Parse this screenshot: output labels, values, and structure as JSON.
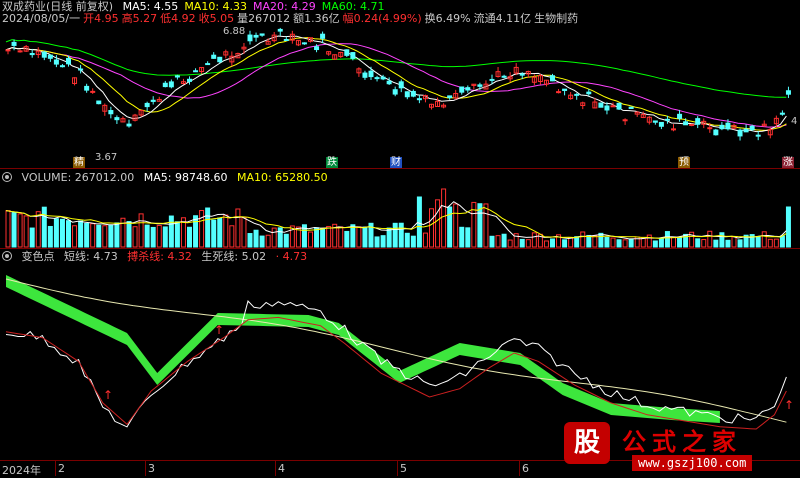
{
  "price_panel": {
    "title": "双成药业(日线 前复权)",
    "ma_items": [
      {
        "label": "MA5: 4.55",
        "color": "#ffffff"
      },
      {
        "label": "MA10: 4.33",
        "color": "#ffff00"
      },
      {
        "label": "MA20: 4.29",
        "color": "#ff44ff"
      },
      {
        "label": "MA60: 4.71",
        "color": "#00ff00"
      }
    ],
    "info_line": [
      {
        "label": "2024/08/05/一",
        "color": "#c8c8c8"
      },
      {
        "label": "开4.95",
        "color": "#ff3030"
      },
      {
        "label": "高5.27",
        "color": "#ff3030"
      },
      {
        "label": "低4.92",
        "color": "#ff3030"
      },
      {
        "label": "收5.05",
        "color": "#ff3030"
      },
      {
        "label": "量267012",
        "color": "#c8c8c8"
      },
      {
        "label": "额1.36亿",
        "color": "#c8c8c8"
      },
      {
        "label": "幅0.24(4.99%)",
        "color": "#ff3030"
      },
      {
        "label": "换6.49%",
        "color": "#c8c8c8"
      },
      {
        "label": "流通4.11亿",
        "color": "#c8c8c8"
      },
      {
        "label": "生物制药",
        "color": "#c8c8c8"
      }
    ],
    "high_label": "6.88",
    "low_label": "3.67",
    "right_label": "4",
    "tags": [
      {
        "text": "精",
        "color": "#ffffff",
        "bg": "#8a5a00"
      },
      {
        "text": "跌",
        "color": "#ffffff",
        "bg": "#008a3a"
      },
      {
        "text": "财",
        "color": "#ffffff",
        "bg": "#2050c0"
      },
      {
        "text": "预",
        "color": "#ffffff",
        "bg": "#8a5a00"
      },
      {
        "text": "涨",
        "color": "#ffffff",
        "bg": "#8a2030"
      }
    ]
  },
  "volume_panel": {
    "label": "VOLUME: 267012.00",
    "ma5": "MA5: 98748.60",
    "ma10": "MA10: 65280.50"
  },
  "indicator_panel": {
    "name": "变色点",
    "short_line": "短线: 4.73",
    "hunt_line": "搏杀线: 4.32",
    "life_line": "生死线: 5.02",
    "extra": "· 4.73"
  },
  "x_axis": [
    "2024年",
    "2",
    "3",
    "4",
    "5",
    "6"
  ],
  "watermark": {
    "mark": "股",
    "name": "公式之家",
    "url": "www.gszj100.com"
  },
  "colors": {
    "up": "#ff3030",
    "down": "#54ffff",
    "ma5": "#ffffff",
    "ma10": "#ffff00",
    "ma20": "#ff44ff",
    "ma60": "#00ff00"
  }
}
